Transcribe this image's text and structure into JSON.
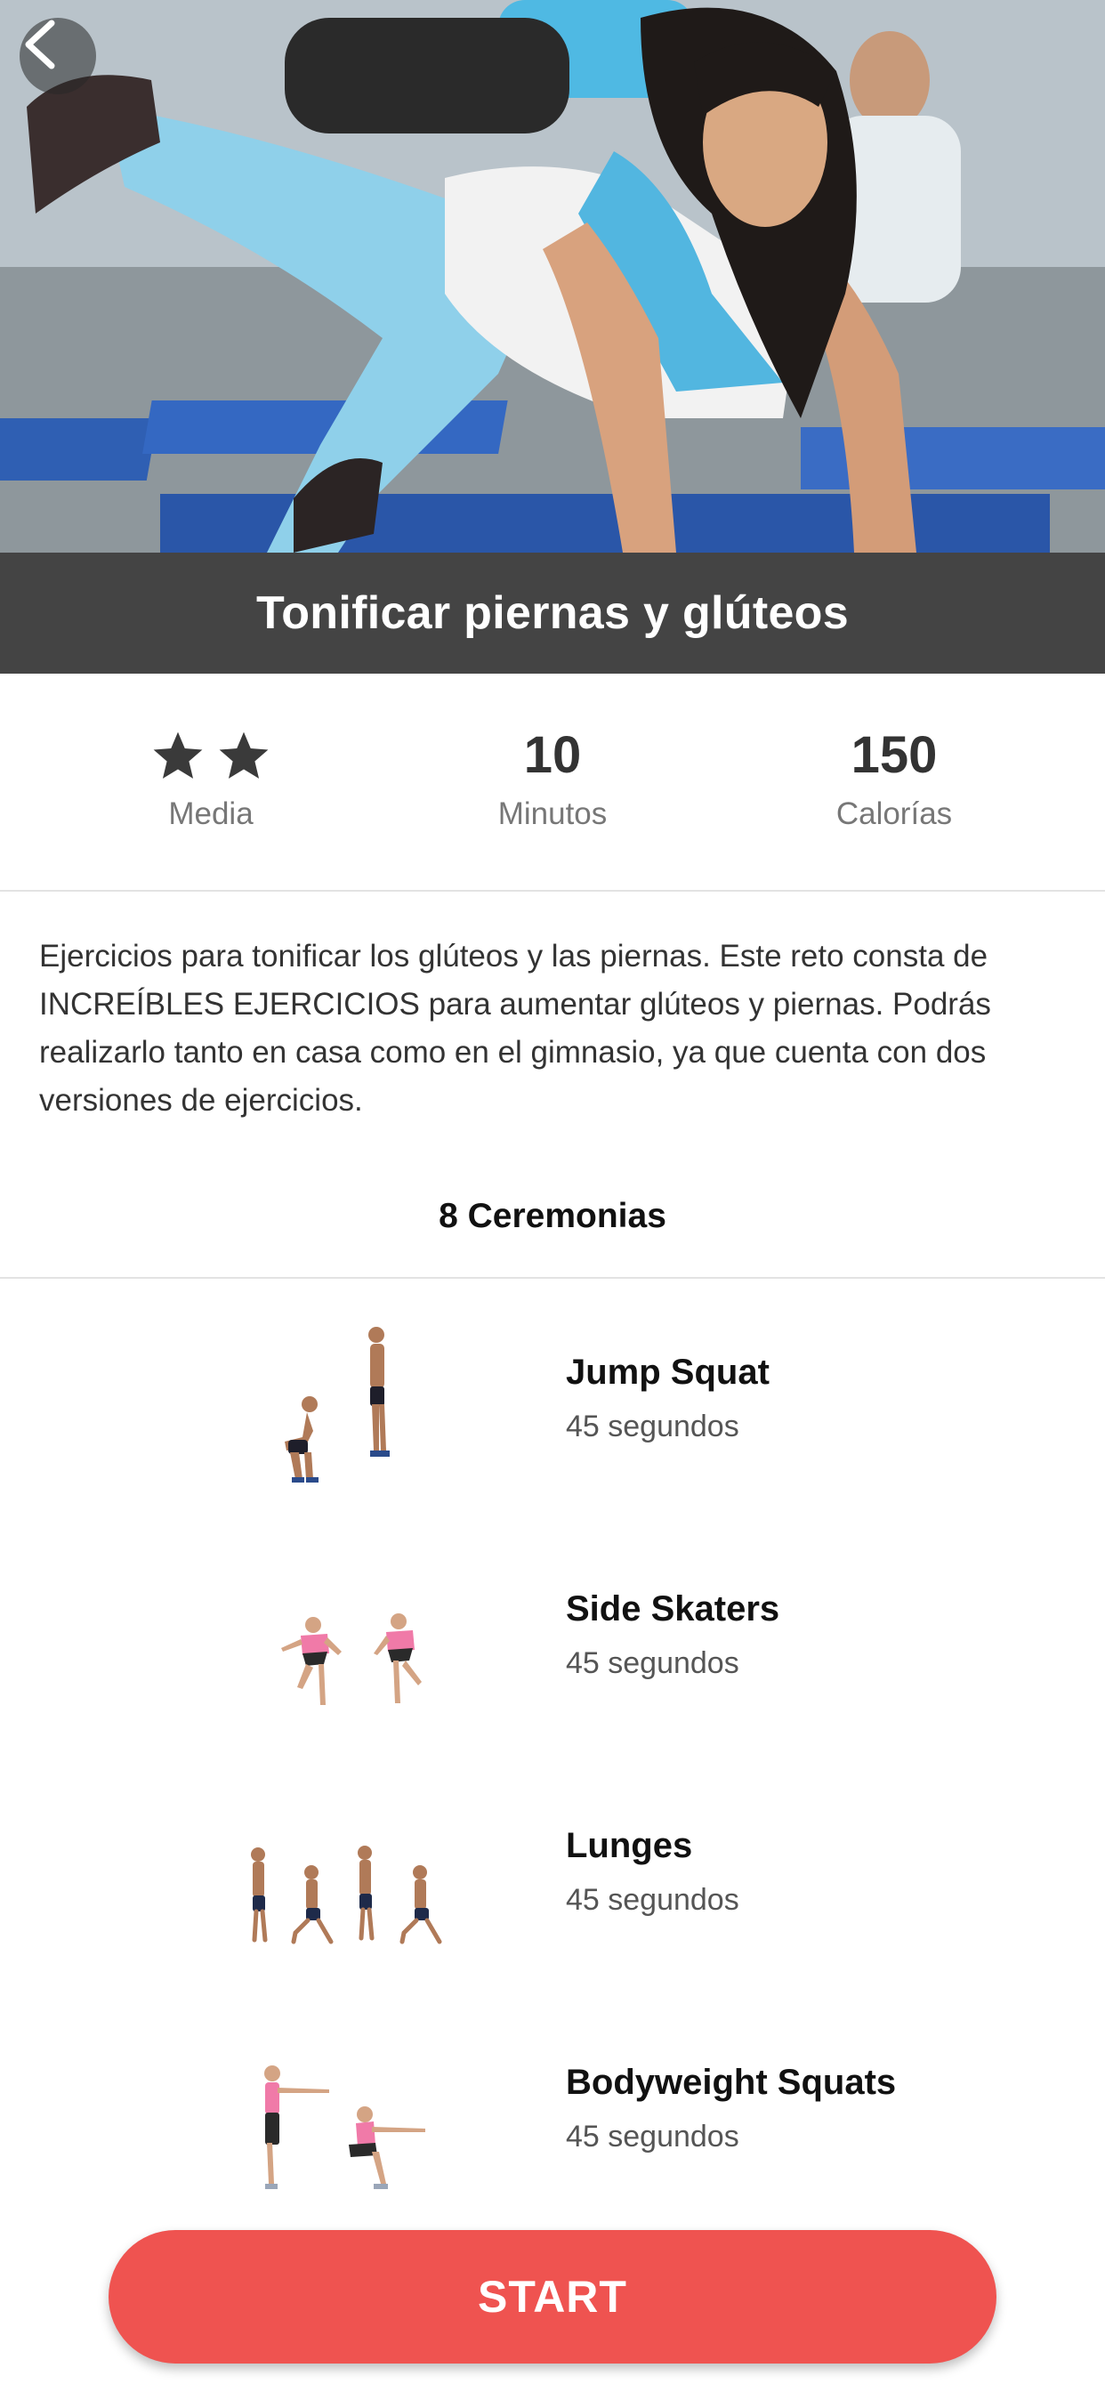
{
  "header": {
    "title": "Tonificar piernas y glúteos"
  },
  "stats": {
    "difficulty": {
      "stars": 2,
      "label": "Media"
    },
    "duration": {
      "value": "10",
      "label": "Minutos"
    },
    "calories": {
      "value": "150",
      "label": "Calorías"
    }
  },
  "description": "Ejercicios para tonificar los glúteos y las piernas. Este reto consta de INCREÍBLES EJERCICIOS para aumentar glúteos y piernas. Podrás realizarlo tanto en casa como en el gimnasio, ya que cuenta con dos versiones de ejercicios.",
  "section": {
    "title": "8 Ceremonias"
  },
  "exercises": [
    {
      "name": "Jump Squat",
      "duration": "45 segundos",
      "icon": "jump-squat-figure"
    },
    {
      "name": "Side Skaters",
      "duration": "45 segundos",
      "icon": "side-skaters-figure"
    },
    {
      "name": "Lunges",
      "duration": "45 segundos",
      "icon": "lunges-figure"
    },
    {
      "name": "Bodyweight Squats",
      "duration": "45 segundos",
      "icon": "bodyweight-squats-figure"
    }
  ],
  "actions": {
    "start_label": "START"
  },
  "icons": {
    "back": "chevron-left-icon",
    "star": "star-icon"
  },
  "colors": {
    "accent": "#ef5350",
    "title_bar": "#444444"
  }
}
